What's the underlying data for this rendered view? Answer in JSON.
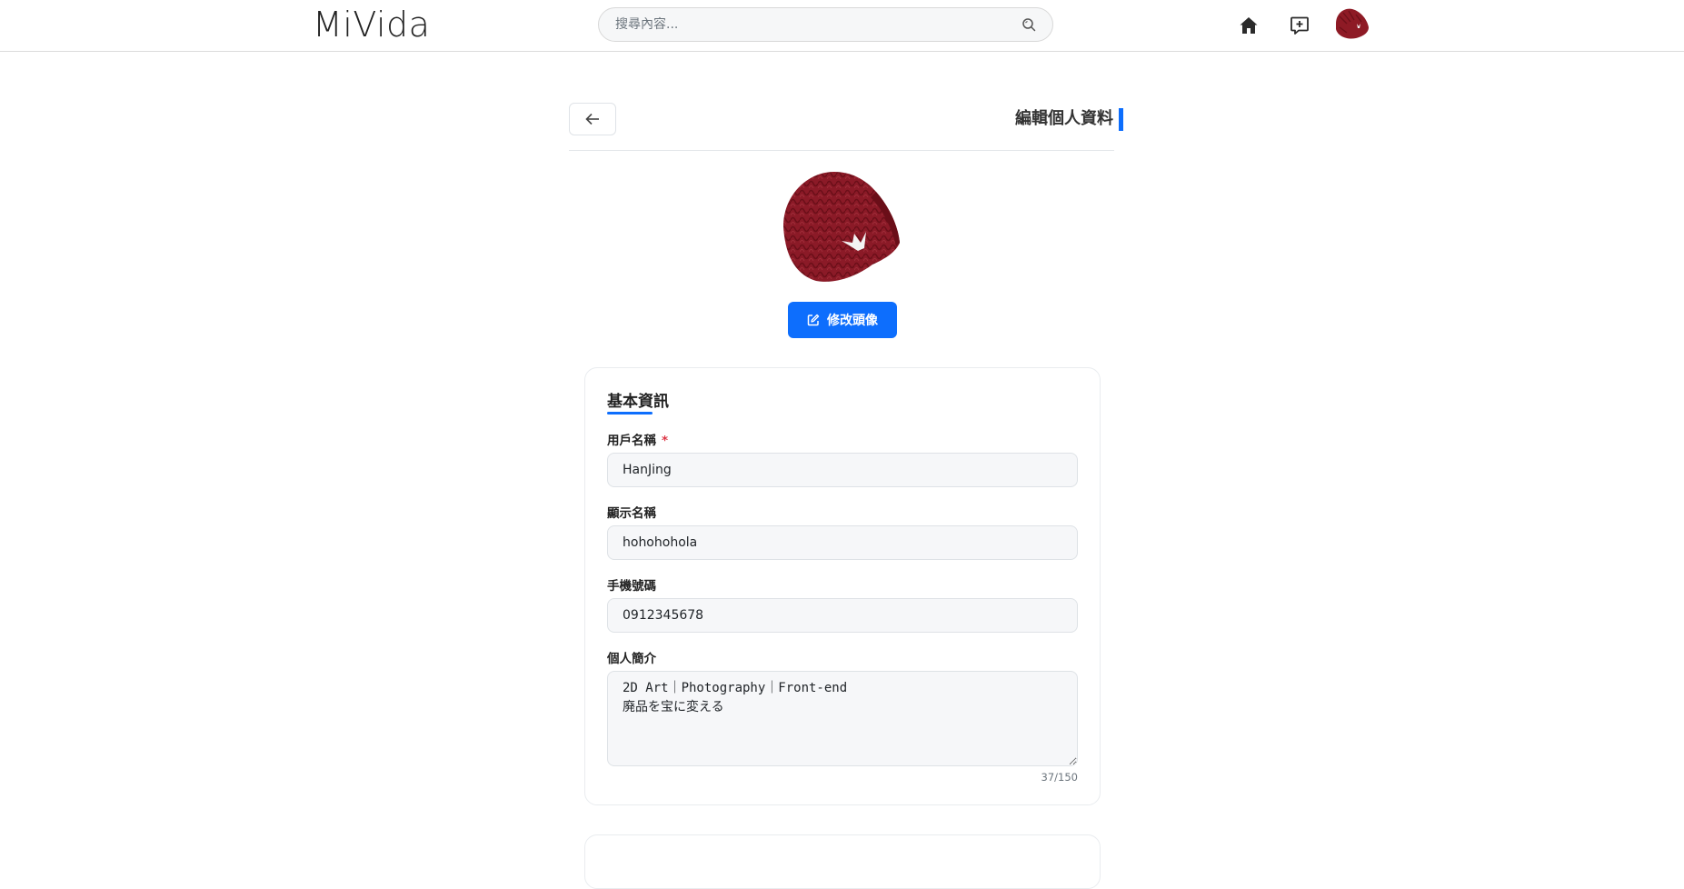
{
  "navbar": {
    "brand": "MiVida",
    "search_placeholder": "搜尋內容...",
    "icons": [
      "home-icon",
      "new-post-icon",
      "user-avatar"
    ]
  },
  "page": {
    "title": "編輯個人資料",
    "accent_color": "#0d6efd"
  },
  "avatar": {
    "change_button_label": "修改頭像"
  },
  "basic_info": {
    "section_title": "基本資訊",
    "username": {
      "label": "用戶名稱",
      "required_mark": "*",
      "value": "HanJing"
    },
    "display_name": {
      "label": "顯示名稱",
      "value": "hohohohola"
    },
    "phone": {
      "label": "手機號碼",
      "value": "0912345678"
    },
    "bio": {
      "label": "個人簡介",
      "value": "2D Art｜Photography｜Front-end\n廃品を宝に変える",
      "char_count": "37/150"
    }
  }
}
